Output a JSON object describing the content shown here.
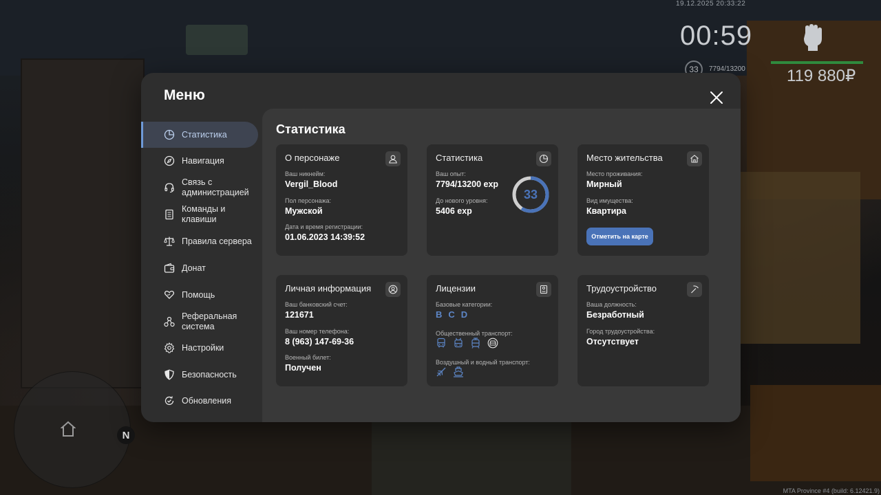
{
  "hud": {
    "datetime": "19.12.2025 20:33:22",
    "time": "00:59",
    "level": "33",
    "exp": "7794/13200",
    "money": "119 880₽",
    "build": "MTA Province #4 (build: 6.12421.9)",
    "compass": "N"
  },
  "menu": {
    "title": "Меню",
    "sidebar": [
      {
        "label": "Статистика",
        "icon": "pie-chart-icon"
      },
      {
        "label": "Навигация",
        "icon": "compass-icon"
      },
      {
        "label": "Связь с администрацией",
        "icon": "headset-icon"
      },
      {
        "label": "Команды и клавиши",
        "icon": "document-icon"
      },
      {
        "label": "Правила сервера",
        "icon": "scales-icon"
      },
      {
        "label": "Донат",
        "icon": "wallet-icon"
      },
      {
        "label": "Помощь",
        "icon": "heart-hand-icon"
      },
      {
        "label": "Реферальная система",
        "icon": "network-icon"
      },
      {
        "label": "Настройки",
        "icon": "gear-icon"
      },
      {
        "label": "Безопасность",
        "icon": "shield-icon"
      },
      {
        "label": "Обновления",
        "icon": "refresh-check-icon"
      }
    ]
  },
  "content": {
    "title": "Статистика",
    "character": {
      "title": "О персонаже",
      "nickname_label": "Ваш никнейм:",
      "nickname": "Vergil_Blood",
      "gender_label": "Пол персонажа:",
      "gender": "Мужской",
      "reg_label": "Дата и время регистрации:",
      "reg": "01.06.2023 14:39:52"
    },
    "stats": {
      "title": "Статистика",
      "exp_label": "Ваш опыт:",
      "exp": "7794/13200 exp",
      "next_label": "До нового уровня:",
      "next": "5406 exp",
      "level": "33",
      "progress": 0.59
    },
    "residence": {
      "title": "Место жительства",
      "place_label": "Место проживания:",
      "place": "Мирный",
      "property_label": "Вид имущества:",
      "property": "Квартира",
      "button": "Отметить на карте"
    },
    "personal": {
      "title": "Личная информация",
      "bank_label": "Ваш банковский счет:",
      "bank": "121671",
      "phone_label": "Ваш номер телефона:",
      "phone": "8 (963) 147-69-36",
      "military_label": "Военный билет:",
      "military": "Получен"
    },
    "licenses": {
      "title": "Лицензии",
      "basic_label": "Базовые категории:",
      "basic": [
        "B",
        "C",
        "D"
      ],
      "public_label": "Общественный транспорт:",
      "air_label": "Воздушный и водный транспорт:"
    },
    "employment": {
      "title": "Трудоустройство",
      "position_label": "Ваша должность:",
      "position": "Безработный",
      "city_label": "Город трудоустройства:",
      "city": "Отсутствует"
    }
  },
  "colors": {
    "accent": "#4a73b8",
    "ring_fill": "#4a73b8",
    "ring_track": "#cfcfcf"
  }
}
